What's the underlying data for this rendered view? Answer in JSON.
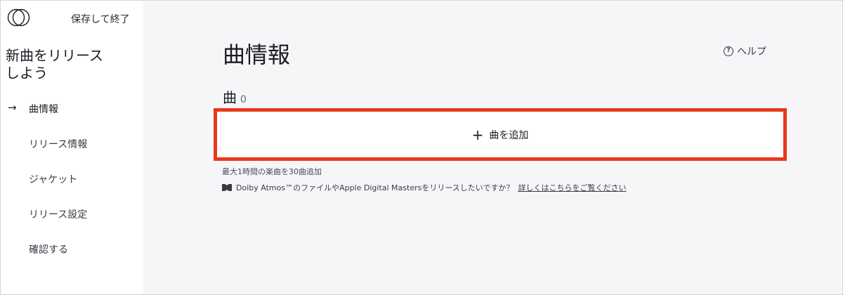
{
  "sidebar": {
    "save_exit_label": "保存して終了",
    "title": "新曲をリリースしよう",
    "items": [
      {
        "label": "曲情報",
        "active": true
      },
      {
        "label": "リリース情報",
        "active": false
      },
      {
        "label": "ジャケット",
        "active": false
      },
      {
        "label": "リリース設定",
        "active": false
      },
      {
        "label": "確認する",
        "active": false
      }
    ],
    "active_arrow": "→"
  },
  "main": {
    "title": "曲情報",
    "help_label": "ヘルプ",
    "songs_heading": "曲",
    "songs_count": "0",
    "add_button_label": "曲を追加",
    "limit_note": "最大1時間の楽曲を30曲追加",
    "dolby_text": "Dolby Atmos™のファイルやApple Digital Mastersをリリースしたいですか？",
    "dolby_link": "詳しくはこちらをご覧ください"
  },
  "colors": {
    "highlight_border": "#e8381c",
    "main_background": "#f6f6f9"
  },
  "icons": {
    "logo": "logo-icon",
    "help": "help-icon",
    "arrow": "arrow-right-icon",
    "plus": "plus-icon",
    "dolby": "dolby-icon"
  }
}
